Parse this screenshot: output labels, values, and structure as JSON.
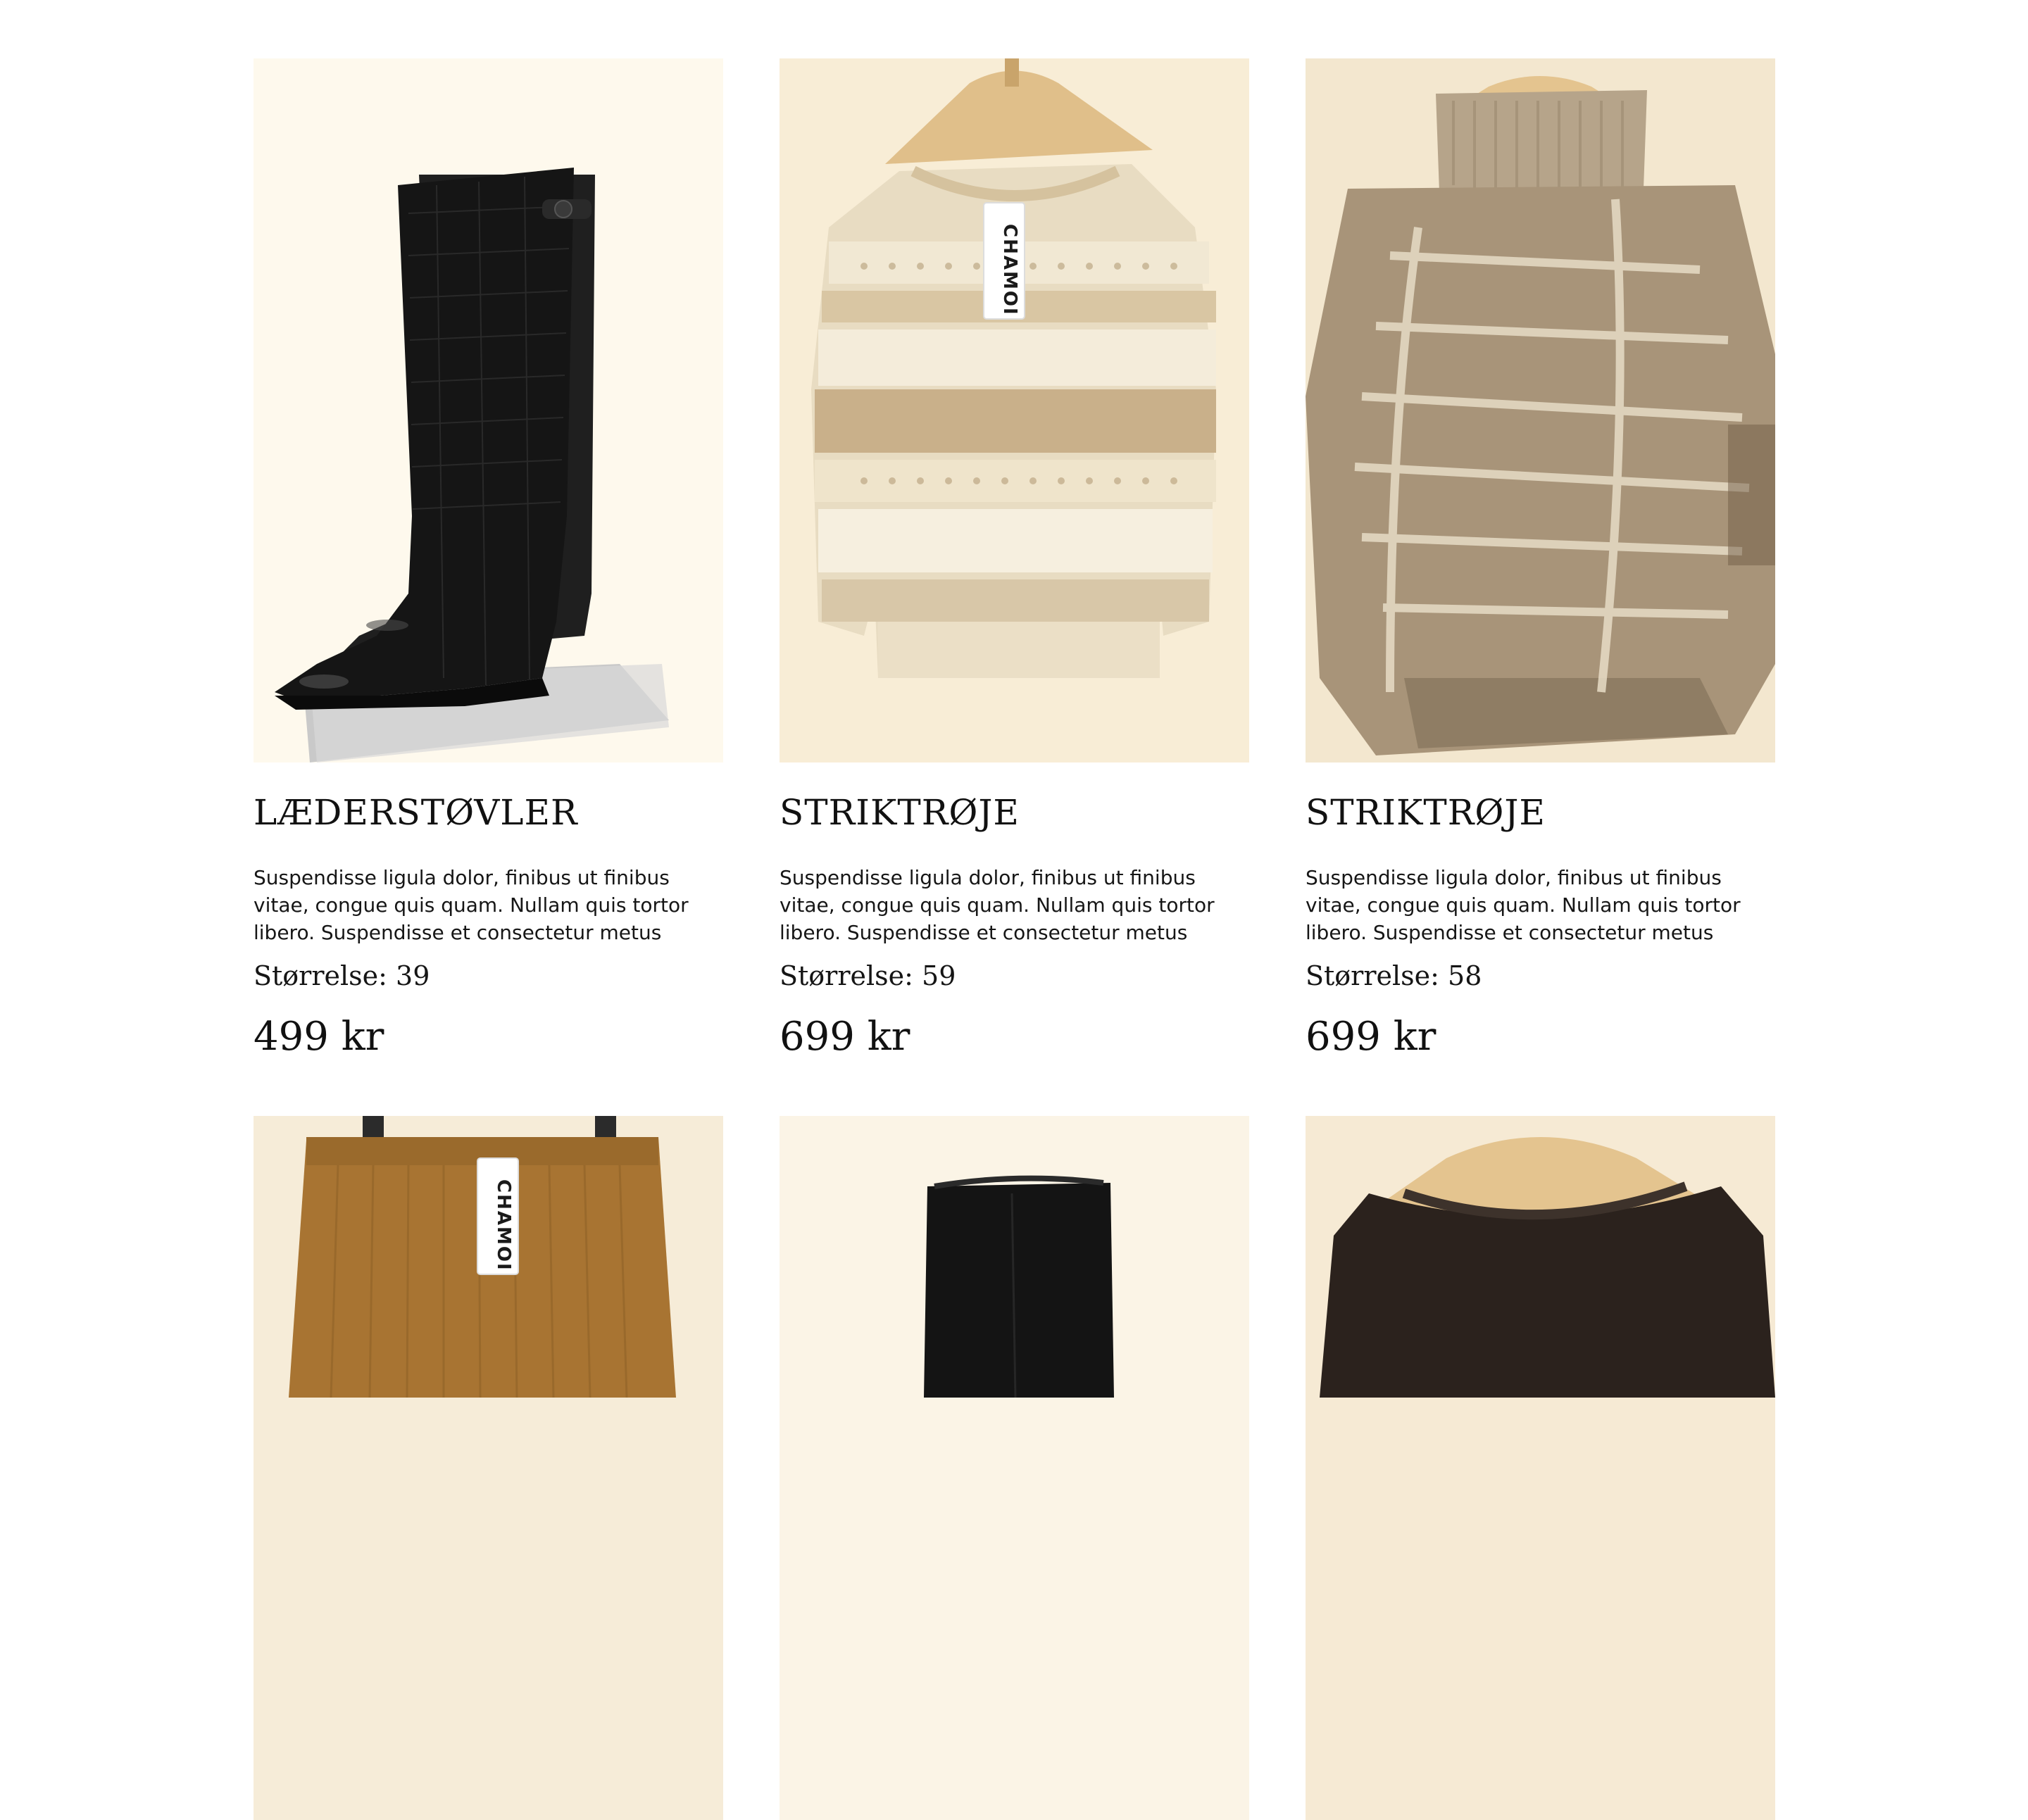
{
  "products": [
    {
      "title": "LÆDERSTØVLER",
      "description": "Suspendisse ligula dolor, finibus ut finibus vitae, congue quis quam. Nullam quis tortor libero. Suspendisse et consectetur metus",
      "size": "Størrelse: 39",
      "price": "499 kr",
      "image": "black-leather-boots"
    },
    {
      "title": "STRIKTRØJE",
      "description": "Suspendisse ligula dolor, finibus ut finibus vitae, congue quis quam. Nullam quis tortor libero. Suspendisse et consectetur metus",
      "size": "Størrelse: 59",
      "price": "699 kr",
      "image": "cream-knit-sweater",
      "tag_text": "CHAMOI"
    },
    {
      "title": "STRIKTRØJE",
      "description": "Suspendisse ligula dolor, finibus ut finibus vitae, congue quis quam. Nullam quis tortor libero. Suspendisse et consectetur metus",
      "size": "Størrelse: 58",
      "price": "699 kr",
      "image": "beige-turtleneck-poncho"
    }
  ],
  "next_row": [
    {
      "image": "brown-corduroy-skirt",
      "tag_text": "CHAMOI"
    },
    {
      "image": "black-suede-boots"
    },
    {
      "image": "dark-brown-knit-top"
    }
  ],
  "colors": {
    "background": "#ffffff",
    "text": "#111111",
    "photo_backdrop": "#faf4e6"
  }
}
